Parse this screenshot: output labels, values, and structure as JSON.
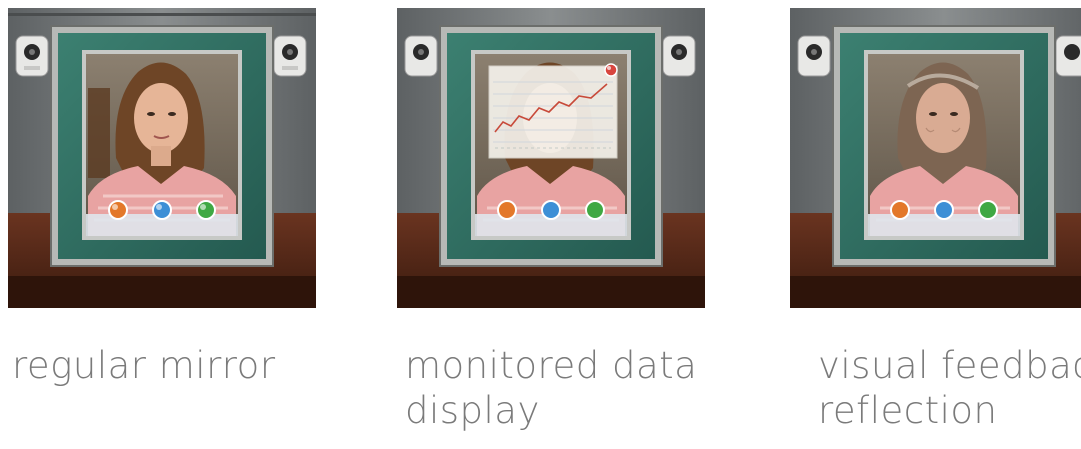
{
  "panels": [
    {
      "caption": "regular mirror",
      "overlay": "none",
      "buttons": [
        {
          "icon": "orange-orb-icon",
          "color": "#e3782a"
        },
        {
          "icon": "blue-orb-icon",
          "color": "#3d8fd6"
        },
        {
          "icon": "green-orb-icon",
          "color": "#3fa843"
        }
      ]
    },
    {
      "caption": "monitored data\ndisplay",
      "overlay": "line-chart",
      "buttons": [
        {
          "icon": "orange-orb-icon",
          "color": "#e3782a"
        },
        {
          "icon": "blue-orb-icon",
          "color": "#3d8fd6"
        },
        {
          "icon": "green-orb-icon",
          "color": "#3fa843"
        }
      ]
    },
    {
      "caption": "visual feedbac\nreflection",
      "overlay": "aged-reflection",
      "buttons": [
        {
          "icon": "orange-orb-icon",
          "color": "#e3782a"
        },
        {
          "icon": "blue-orb-icon",
          "color": "#3d8fd6"
        },
        {
          "icon": "green-orb-icon",
          "color": "#3fa843"
        }
      ]
    }
  ],
  "colors": {
    "frame_teal": "#2e6f63",
    "frame_silver": "#a9aca9",
    "wall": "#777b7c",
    "desk": "#5b2a17",
    "shirt": "#e49a9a",
    "hair": "#6e4526",
    "chart_line": "#c84a3a"
  }
}
